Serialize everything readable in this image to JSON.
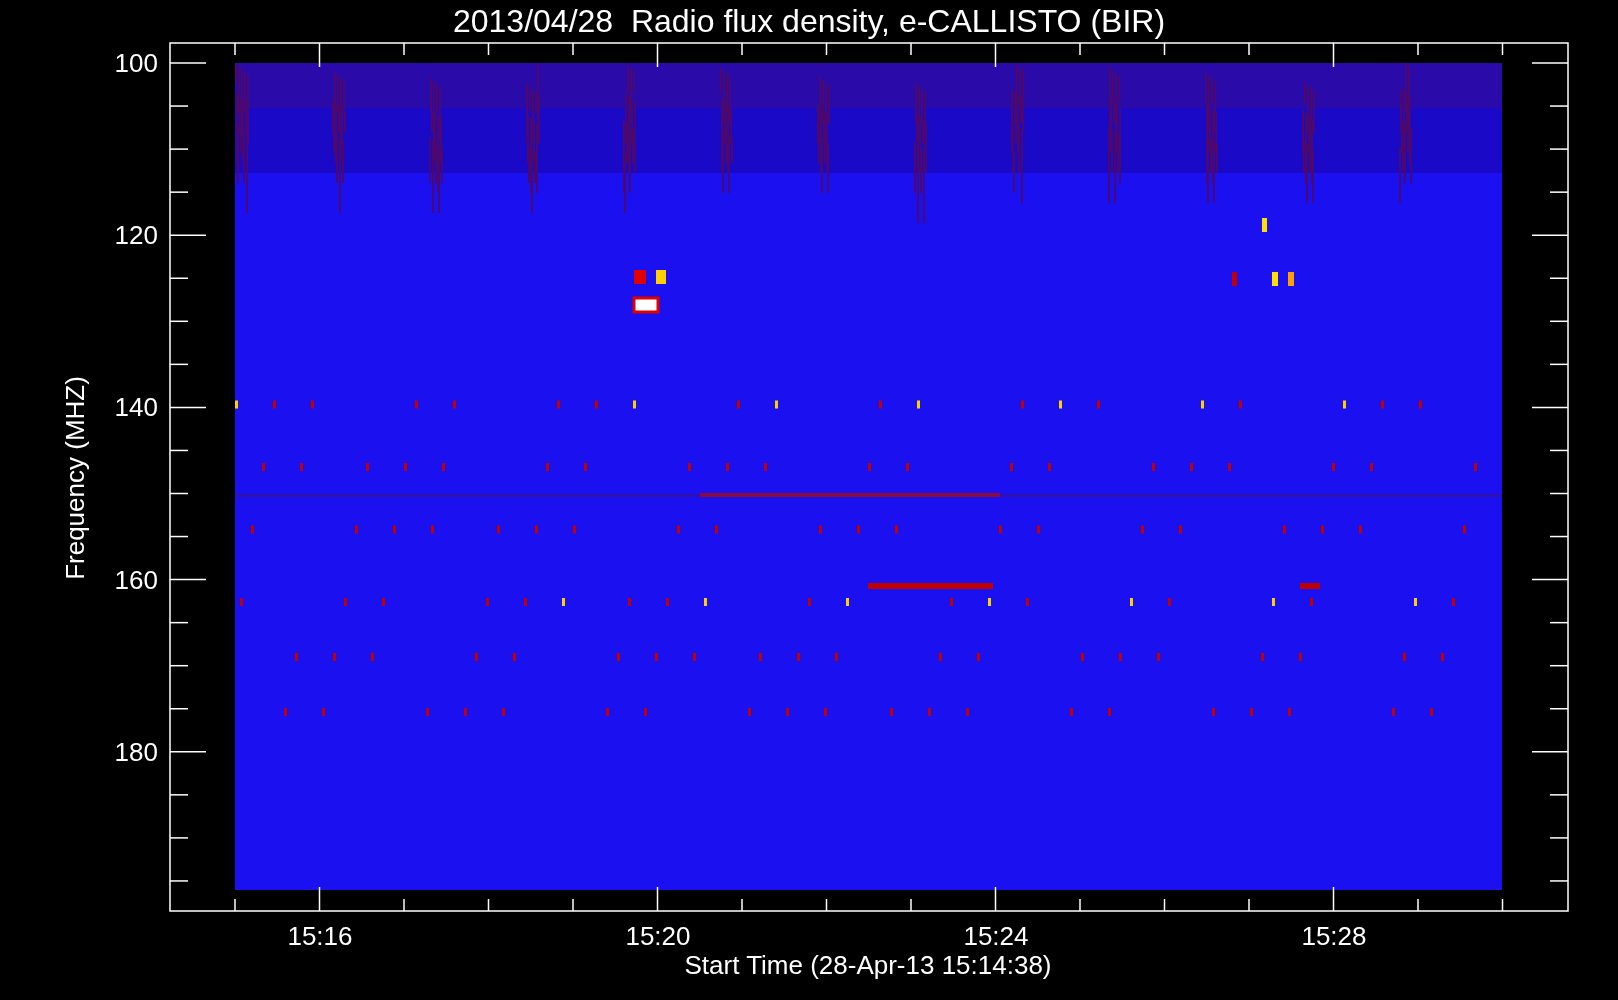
{
  "title": "2013/04/28  Radio flux density, e-CALLISTO (BIR)",
  "y_axis": {
    "label": "Frequency (MHZ)",
    "ticks": [
      "100",
      "120",
      "140",
      "160",
      "180"
    ]
  },
  "x_axis": {
    "label": "Start Time (28-Apr-13 15:14:38)",
    "ticks": [
      "15:16",
      "15:20",
      "15:24",
      "15:28"
    ]
  }
}
